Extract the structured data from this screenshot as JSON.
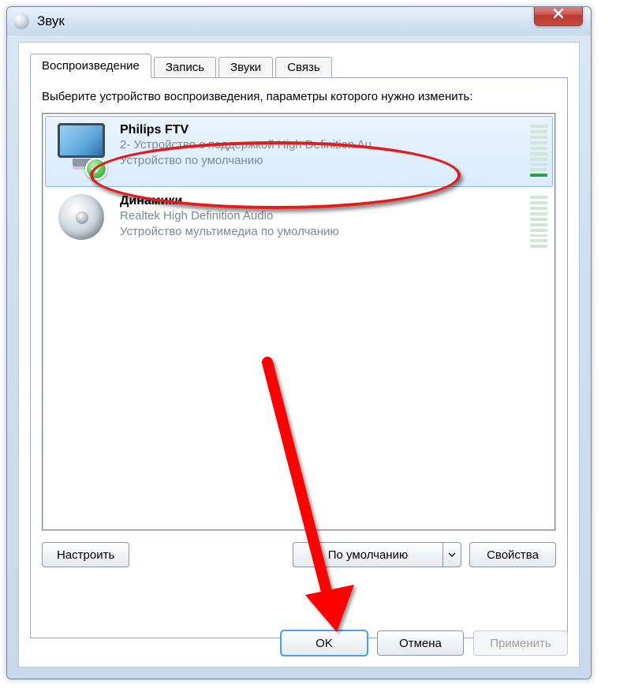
{
  "window": {
    "title": "Звук"
  },
  "tabs": [
    {
      "label": "Воспроизведение",
      "active": true
    },
    {
      "label": "Запись",
      "active": false
    },
    {
      "label": "Звуки",
      "active": false
    },
    {
      "label": "Связь",
      "active": false
    }
  ],
  "instruction": "Выберите устройство воспроизведения, параметры которого нужно изменить:",
  "devices": [
    {
      "name": "Philips FTV",
      "line1": "2- Устройство с поддержкой High Definition Au...",
      "line2": "Устройство по умолчанию",
      "selected": true,
      "default": true,
      "level_bars_on": 1,
      "level_bars_total": 10
    },
    {
      "name": "Динамики",
      "line1": "Realtek High Definition Audio",
      "line2": "Устройство мультимедиа по умолчанию",
      "selected": false,
      "default": false,
      "level_bars_on": 0,
      "level_bars_total": 10
    }
  ],
  "buttons": {
    "configure": "Настроить",
    "set_default": "По умолчанию",
    "properties": "Свойства",
    "ok": "OK",
    "cancel": "Отмена",
    "apply": "Применить"
  },
  "annotations": {
    "circle": "red-circle-highlight",
    "arrow": "red-arrow-to-ok"
  }
}
